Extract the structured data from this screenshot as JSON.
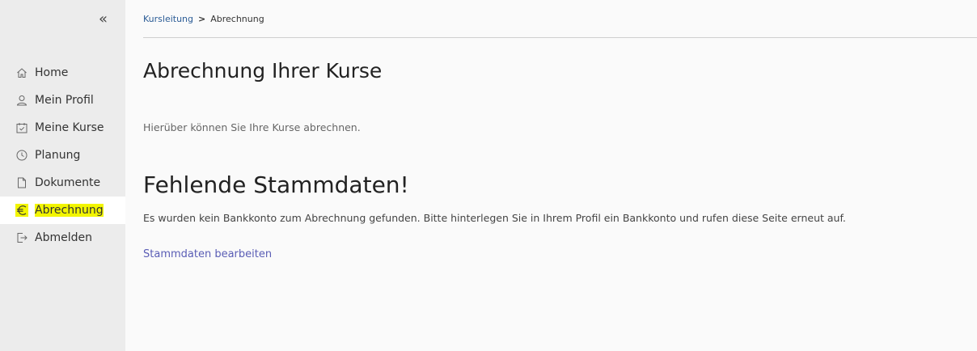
{
  "sidebar": {
    "collapse_glyph": "«",
    "items": [
      {
        "label": "Home",
        "icon": "home-icon"
      },
      {
        "label": "Mein Profil",
        "icon": "user-icon"
      },
      {
        "label": "Meine Kurse",
        "icon": "calendar-check-icon"
      },
      {
        "label": "Planung",
        "icon": "clock-icon"
      },
      {
        "label": "Dokumente",
        "icon": "document-icon"
      },
      {
        "label": "Abrechnung",
        "icon": "euro-icon",
        "active": true
      },
      {
        "label": "Abmelden",
        "icon": "logout-icon"
      }
    ],
    "highlight_color": "#f2f500"
  },
  "breadcrumb": {
    "parent": "Kursleitung",
    "separator": ">",
    "current": "Abrechnung"
  },
  "main": {
    "title": "Abrechnung Ihrer Kurse",
    "intro": "Hierüber können Sie Ihre Kurse abrechnen.",
    "warning_title": "Fehlende Stammdaten!",
    "warning_text": "Es wurden kein Bankkonto zum Abrechnung gefunden. Bitte hinterlegen Sie in Ihrem Profil ein Bankkonto und rufen diese Seite erneut auf.",
    "edit_link": "Stammdaten bearbeiten"
  },
  "colors": {
    "link": "#2a5b95",
    "action_link": "#5a5db5"
  }
}
